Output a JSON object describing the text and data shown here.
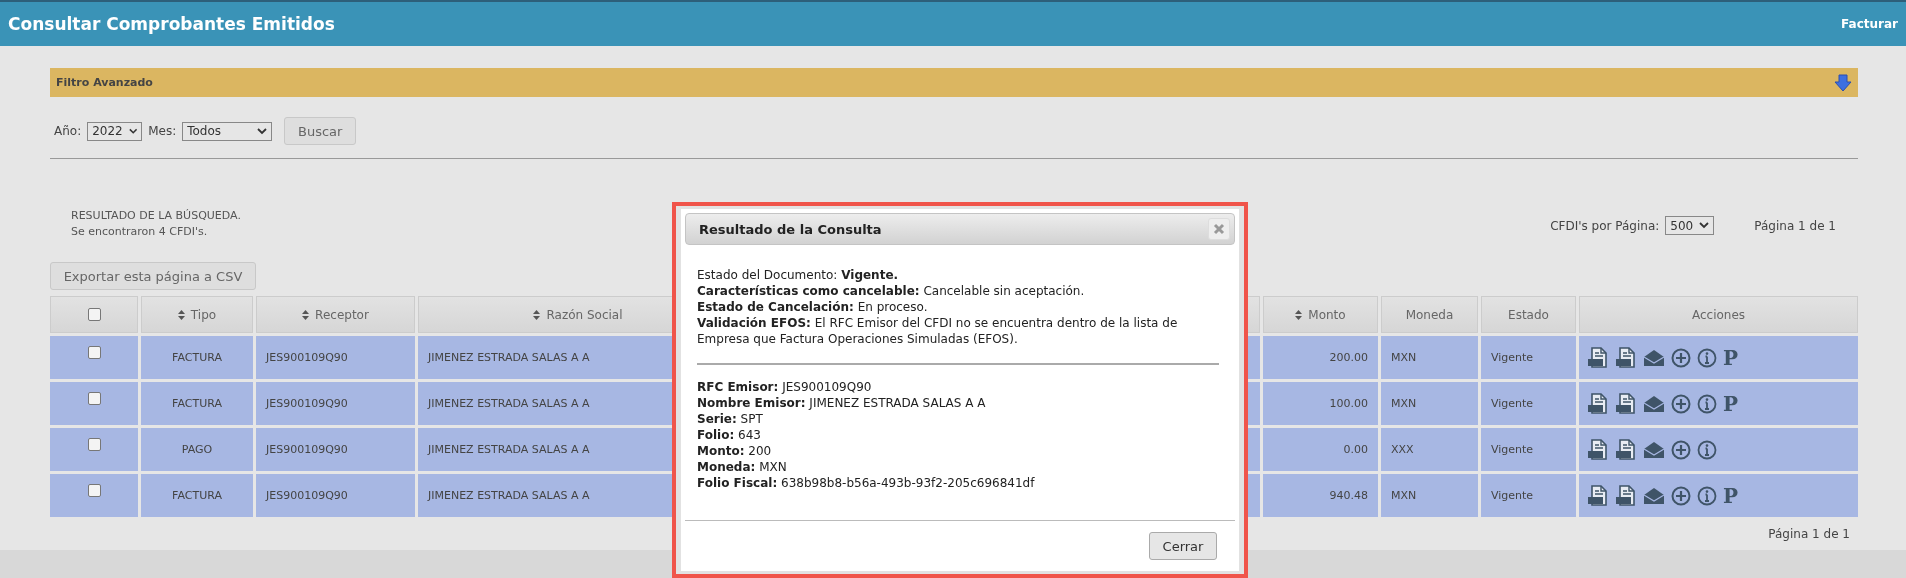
{
  "header": {
    "title": "Consultar Comprobantes Emitidos",
    "link": "Facturar"
  },
  "filter": {
    "title": "Filtro Avanzado"
  },
  "search": {
    "year_label": "Año:",
    "year": "2022",
    "month_label": "Mes:",
    "month": "Todos",
    "button": "Buscar"
  },
  "results": {
    "heading": "RESULTADO DE LA BÚSQUEDA.",
    "count": "Se encontraron 4 CFDI's.",
    "export_button": "Exportar esta página a CSV",
    "per_page_label": "CFDI's por Página:",
    "per_page": "500",
    "page_info": "Página 1 de 1"
  },
  "table": {
    "header_checked": false,
    "columns": [
      {
        "label": "Tipo",
        "sortable": true
      },
      {
        "label": "Receptor",
        "sortable": true
      },
      {
        "label": "Razón Social",
        "sortable": true
      },
      {
        "label": "Monto",
        "sortable": true
      },
      {
        "label": "Moneda",
        "sortable": false
      },
      {
        "label": "Estado",
        "sortable": false
      },
      {
        "label": "Acciones",
        "sortable": false
      }
    ],
    "rows": [
      {
        "checked": false,
        "tipo": "FACTURA",
        "receptor": "JES900109Q90",
        "razon_social": "JIMENEZ ESTRADA SALAS A A",
        "monto": "200.00",
        "moneda": "MXN",
        "estado": "Vigente",
        "actions": [
          {
            "kind": "xml"
          },
          {
            "kind": "pdf"
          },
          {
            "kind": "mail"
          },
          {
            "kind": "add"
          },
          {
            "kind": "info"
          },
          {
            "kind": "glyph",
            "label": "P"
          }
        ]
      },
      {
        "checked": false,
        "tipo": "FACTURA",
        "receptor": "JES900109Q90",
        "razon_social": "JIMENEZ ESTRADA SALAS A A",
        "monto": "100.00",
        "moneda": "MXN",
        "estado": "Vigente",
        "actions": [
          {
            "kind": "xml"
          },
          {
            "kind": "pdf"
          },
          {
            "kind": "mail"
          },
          {
            "kind": "add"
          },
          {
            "kind": "info"
          },
          {
            "kind": "glyph",
            "label": "P"
          }
        ]
      },
      {
        "checked": false,
        "tipo": "PAGO",
        "receptor": "JES900109Q90",
        "razon_social": "JIMENEZ ESTRADA SALAS A A",
        "monto": "0.00",
        "moneda": "XXX",
        "estado": "Vigente",
        "actions": [
          {
            "kind": "xml"
          },
          {
            "kind": "pdf"
          },
          {
            "kind": "mail"
          },
          {
            "kind": "add"
          },
          {
            "kind": "info"
          }
        ]
      },
      {
        "checked": false,
        "tipo": "FACTURA",
        "receptor": "JES900109Q90",
        "razon_social": "JIMENEZ ESTRADA SALAS A A",
        "monto": "940.48",
        "moneda": "MXN",
        "estado": "Vigente",
        "actions": [
          {
            "kind": "xml"
          },
          {
            "kind": "pdf"
          },
          {
            "kind": "mail"
          },
          {
            "kind": "add"
          },
          {
            "kind": "info"
          },
          {
            "kind": "glyph",
            "label": "P"
          }
        ]
      }
    ]
  },
  "footer_page_info": "Página 1 de 1",
  "modal": {
    "title": "Resultado de la Consulta",
    "status_lines": [
      "Estado del Documento: **Vigente.**",
      "**Características como cancelable:** Cancelable sin aceptación.",
      "**Estado de Cancelación:** En proceso.",
      "**Validación EFOS:** El RFC Emisor del CFDI no se encuentra dentro de la lista de Empresa que Factura Operaciones Simuladas (EFOS)."
    ],
    "details": [
      "**RFC Emisor:** JES900109Q90",
      "**Nombre Emisor:** JIMENEZ ESTRADA SALAS A A",
      "**Serie:** SPT",
      "**Folio:** 643",
      "**Monto:** 200",
      "**Moneda:** MXN",
      "**Folio Fiscal:** 638b98b8-b56a-493b-93f2-205c696841df"
    ],
    "close_button": "Cerrar"
  }
}
